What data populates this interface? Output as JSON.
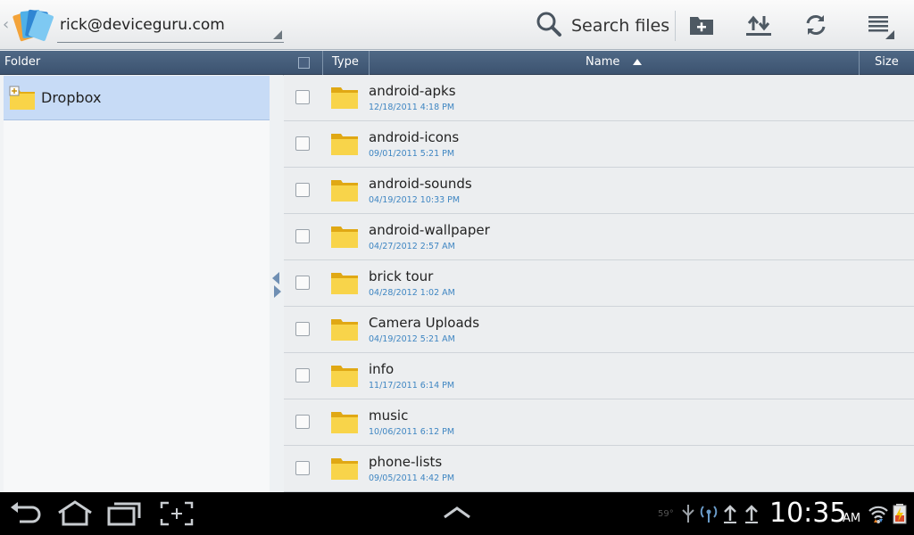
{
  "actionbar": {
    "back_glyph": "‹",
    "account": "rick@deviceguru.com",
    "search_label": "Search files",
    "icons": [
      "new-folder-icon",
      "upload-download-icon",
      "refresh-icon",
      "overflow-menu-icon"
    ]
  },
  "folder_pane": {
    "header": "Folder",
    "items": [
      {
        "label": "Dropbox"
      }
    ]
  },
  "list": {
    "columns": {
      "type": "Type",
      "name": "Name",
      "size": "Size"
    },
    "sort": "name-ascending",
    "rows": [
      {
        "name": "android-apks",
        "date": "12/18/2011 4:18 PM"
      },
      {
        "name": "android-icons",
        "date": "09/01/2011 5:21 PM"
      },
      {
        "name": "android-sounds",
        "date": "04/19/2012 10:33 PM"
      },
      {
        "name": "android-wallpaper",
        "date": "04/27/2012 2:57 AM"
      },
      {
        "name": "brick tour",
        "date": "04/28/2012 1:02 AM"
      },
      {
        "name": "Camera Uploads",
        "date": "04/19/2012 5:21 AM"
      },
      {
        "name": "info",
        "date": "11/17/2011 6:14 PM"
      },
      {
        "name": "music",
        "date": "10/06/2011 6:12 PM"
      },
      {
        "name": "phone-lists",
        "date": "09/05/2011 4:42 PM"
      }
    ]
  },
  "statusbar": {
    "time": "10:35",
    "ampm": "AM",
    "temperature": "59°",
    "icons": [
      "back-icon",
      "home-icon",
      "recent-apps-icon",
      "screenshot-icon",
      "chevron-up-icon",
      "usb-icon",
      "wireless-icon",
      "upload-icon",
      "upload-icon",
      "wifi-icon",
      "battery-charging-icon"
    ]
  },
  "colors": {
    "header_blue": "#445b78",
    "selected_row": "#c7dbf6",
    "date_text": "#3f86c2",
    "folder_yellow": "#f6c925"
  }
}
